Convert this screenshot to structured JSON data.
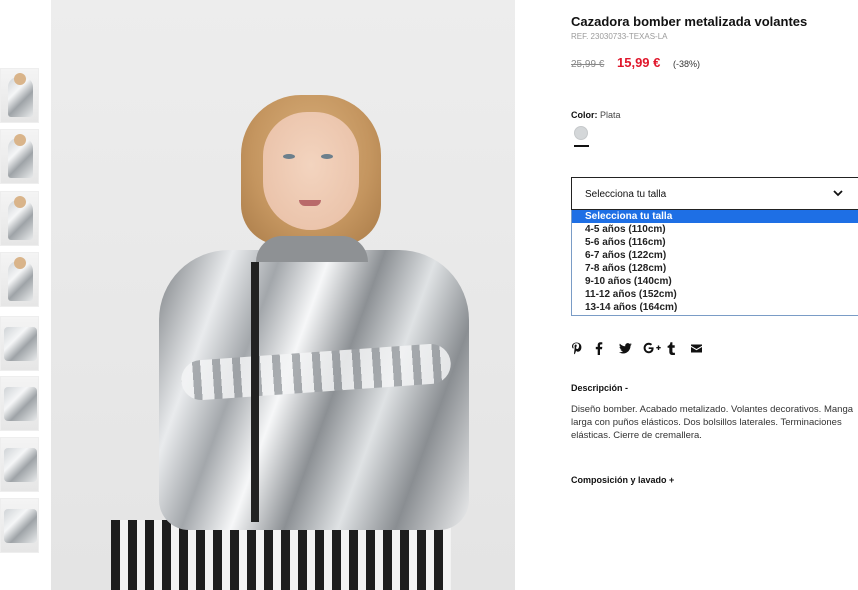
{
  "product": {
    "title": "Cazadora bomber metalizada volantes",
    "ref": "REF. 23030733-TEXAS-LA",
    "old_price": "25,99 €",
    "new_price": "15,99 €",
    "discount": "(-38%)"
  },
  "color": {
    "label": "Color:",
    "value": "Plata",
    "swatch_hex": "#d4d7d9"
  },
  "size_select": {
    "selected": "Selecciona tu talla",
    "options": [
      "Selecciona tu talla",
      "4-5 años (110cm)",
      "5-6 años (116cm)",
      "6-7 años (122cm)",
      "7-8 años (128cm)",
      "9-10 años (140cm)",
      "11-12 años (152cm)",
      "13-14 años (164cm)"
    ]
  },
  "share_icons": [
    "pinterest-icon",
    "facebook-icon",
    "twitter-icon",
    "google-plus-icon",
    "tumblr-icon",
    "email-icon"
  ],
  "description": {
    "heading": "Descripción  -",
    "text": "Diseño bomber. Acabado metalizado. Volantes decorativos. Manga larga con puños elásticos. Dos bolsillos laterales. Terminaciones elásticas. Cierre de cremallera."
  },
  "composition": {
    "heading": "Composición y lavado  +"
  },
  "colors": {
    "sale_red": "#e0162b",
    "highlight_blue": "#1e6fe5"
  }
}
